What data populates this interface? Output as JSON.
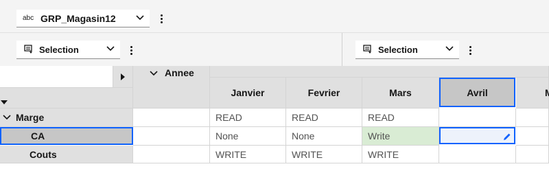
{
  "dimension_selector": {
    "type_label": "abc",
    "value": "GRP_Magasin12"
  },
  "selection_left": {
    "label": "Selection"
  },
  "selection_right": {
    "label": "Selection"
  },
  "grid": {
    "column_dimension": "Annee",
    "columns": [
      "Janvier",
      "Fevrier",
      "Mars",
      "Avril",
      "M"
    ],
    "selected_column": "Avril",
    "rows": [
      {
        "label": "Marge",
        "expandable": true,
        "cells": [
          "READ",
          "READ",
          "READ",
          ""
        ]
      },
      {
        "label": "CA",
        "selected": true,
        "cells": [
          "None",
          "None",
          "Write",
          ""
        ]
      },
      {
        "label": "Couts",
        "cells": [
          "WRITE",
          "WRITE",
          "WRITE",
          ""
        ]
      }
    ]
  },
  "colors": {
    "accent": "#0f62fe",
    "editable_cell": "#d9ecd4",
    "header_bg": "#e0e0e0"
  },
  "icons": [
    "chevron-down-icon",
    "overflow-menu-icon",
    "selection-list-icon",
    "caret-right-icon",
    "caret-down-icon",
    "edit-pencil-icon"
  ]
}
